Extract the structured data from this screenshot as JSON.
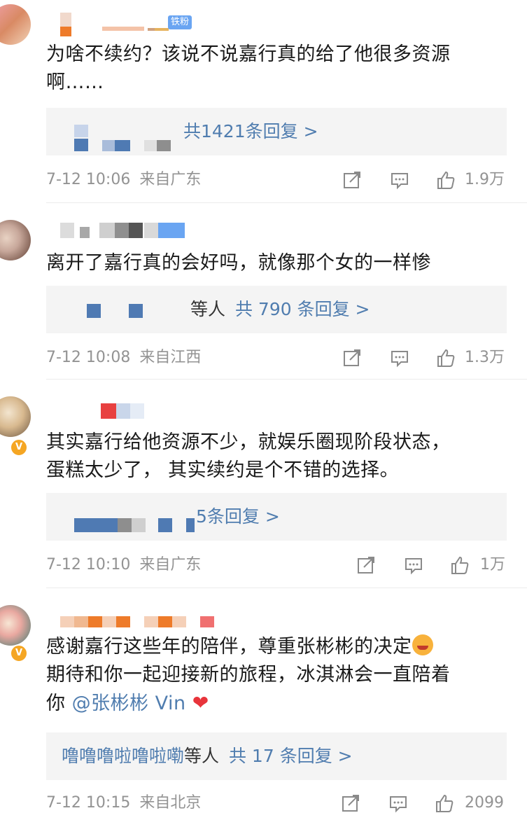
{
  "comments": [
    {
      "badge": "铁粉",
      "text_lines": [
        "为啥不续约？该说不说嘉行真的给了他很多资源",
        "啊……"
      ],
      "reply_summary": "共1421条回复 >",
      "reply_visible_prefix": "ᵗ",
      "time": "7-12 10:06",
      "source": "来自广东",
      "likes": "1.9万"
    },
    {
      "text_lines": [
        "离开了嘉行真的会好吗，就像那个女的一样惨"
      ],
      "reply_suffix": "等人",
      "reply_summary": "共 790 条回复 >",
      "time": "7-12 10:08",
      "source": "来自江西",
      "likes": "1.3万"
    },
    {
      "text_lines": [
        "其实嘉行给他资源不少，就娱乐圈现阶段状态，",
        "蛋糕太少了， 其实续约是个不错的选择。"
      ],
      "reply_summary": "5条回复 >",
      "time": "7-12 10:10",
      "source": "来自广东",
      "likes": "1万"
    },
    {
      "text_line1": "感谢嘉行这些年的陪伴，尊重张彬彬的决定",
      "text_line2": "期待和你一起迎接新的旅程，冰淇淋会一直陪着",
      "text_line3_prefix": "你",
      "mention": "@张彬彬 Vin",
      "reply_names": "噜噜噜啦噜啦嘞",
      "reply_suffix": "等人",
      "reply_summary": "共 17 条回复 >",
      "time": "7-12 10:15",
      "source": "来自北京",
      "likes": "2099"
    }
  ],
  "icons": {
    "forward": "share-arrow-icon",
    "comment": "comment-bubble-icon",
    "like": "thumbs-up-icon",
    "verified": "verified-v-badge-icon",
    "heart": "heart-emoji-icon",
    "emoji": "face-emoji-icon"
  },
  "colors": {
    "link": "#507daf",
    "meta_gray": "#939393",
    "reply_bg": "#f4f4f4",
    "verified_badge": "#f5a623",
    "fan_badge": "#6aa5f2"
  }
}
